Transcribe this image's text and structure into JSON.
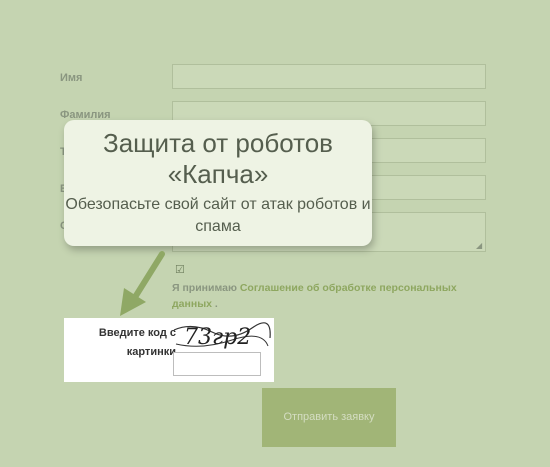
{
  "form": {
    "fields": [
      {
        "label": "Имя"
      },
      {
        "label": "Фамилия"
      },
      {
        "label": "Т"
      },
      {
        "label": "E"
      },
      {
        "label": "С"
      }
    ],
    "consent": {
      "prefix": "Я принимаю ",
      "link": "Соглашение об обработке персональных данных",
      "suffix": " ."
    },
    "captcha": {
      "label": "Введите код с картинки",
      "image_text": "73гр2"
    },
    "submit_label": "Отправить заявку"
  },
  "callout": {
    "title": "Защита от роботов «Капча»",
    "subtitle": "Обезопасьте свой сайт от атак роботов и спама"
  },
  "colors": {
    "background": "#c5d4b1",
    "callout_bg": "#eef3e4",
    "button_bg": "#a1b577",
    "link": "#8ea760",
    "arrow": "#8fa865"
  }
}
